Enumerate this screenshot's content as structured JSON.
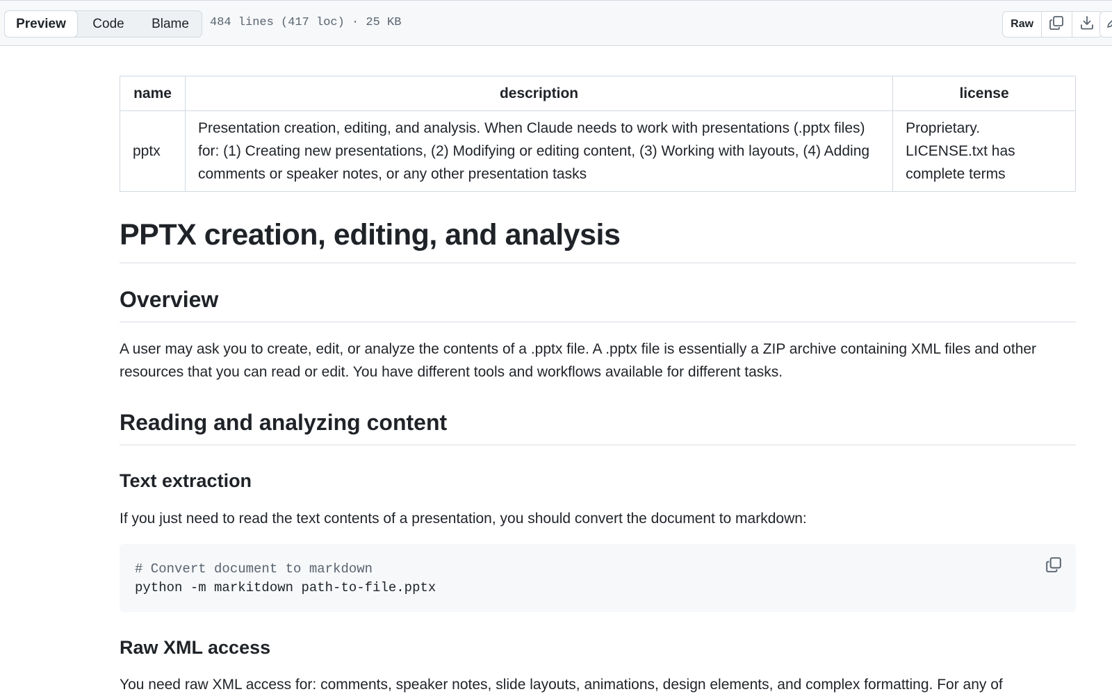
{
  "toolbar": {
    "tabs": [
      {
        "label": "Preview",
        "active": true
      },
      {
        "label": "Code",
        "active": false
      },
      {
        "label": "Blame",
        "active": false
      }
    ],
    "file_meta": "484 lines (417 loc) · 25 KB",
    "raw_label": "Raw",
    "icons": [
      "copy-icon",
      "download-icon",
      "edit-icon"
    ]
  },
  "front_matter_table": {
    "headers": [
      "name",
      "description",
      "license"
    ],
    "row": {
      "name": "pptx",
      "description": "Presentation creation, editing, and analysis. When Claude needs to work with presentations (.pptx files) for: (1) Creating new presentations, (2) Modifying or editing content, (3) Working with layouts, (4) Adding comments or speaker notes, or any other presentation tasks",
      "license": "Proprietary. LICENSE.txt has complete terms"
    }
  },
  "document": {
    "title": "PPTX creation, editing, and analysis",
    "overview_heading": "Overview",
    "overview_text": "A user may ask you to create, edit, or analyze the contents of a .pptx file. A .pptx file is essentially a ZIP archive containing XML files and other resources that you can read or edit. You have different tools and workflows available for different tasks.",
    "reading_heading": "Reading and analyzing content",
    "text_extraction_heading": "Text extraction",
    "text_extraction_text": "If you just need to read the text contents of a presentation, you should convert the document to markdown:",
    "code": {
      "comment": "# Convert document to markdown",
      "command": "python -m markitdown path-to-file.pptx"
    },
    "raw_xml_heading": "Raw XML access",
    "raw_xml_text": "You need raw XML access for: comments, speaker notes, slide layouts, animations, design elements, and complex formatting. For any of"
  },
  "colors": {
    "border": "#d1d9e0",
    "toolbar_bg": "#f6f8fa",
    "text": "#1f2328",
    "muted": "#59636e",
    "code_bg": "#f6f8fa"
  }
}
